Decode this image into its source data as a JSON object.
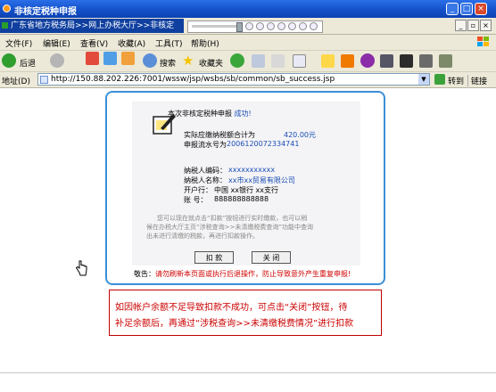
{
  "window": {
    "title": "非核定税种申报",
    "buttons": [
      "_",
      "□",
      "×"
    ]
  },
  "tab": {
    "title": "广东省地方税务局>>网上办税大厅>>非核定"
  },
  "menu": {
    "items": [
      "文件(F)",
      "编辑(E)",
      "查看(V)",
      "收藏(A)",
      "工具(T)",
      "帮助(H)"
    ]
  },
  "toolbar": {
    "back_label": "后退",
    "search_label": "搜索",
    "favorites_label": "收藏夹"
  },
  "address": {
    "label": "地址(D)",
    "url": "http://150.88.202.226:7001/wssw/jsp/wsbs/sb/common/sb_success.jsp",
    "go_label": "转到",
    "links_label": "链接"
  },
  "result": {
    "heading_prefix": "本次非核定税种申报",
    "heading_status": "成功!",
    "total_label": "实际应缴纳税额合计为",
    "total_value": "420.00元",
    "serial_label": "申报流水号为",
    "serial_value": "2006120072334741",
    "taxpayer_code_label": "纳税人编码：",
    "taxpayer_code_value": "xxxxxxxxxxx",
    "taxpayer_name_label": "纳税人名称：",
    "taxpayer_name_value": "xx市xx贸易有限公司",
    "bank_label": "开户行：",
    "bank_value": "中国 xx银行 xx支行",
    "account_label": "账    号：",
    "account_value": "888888888888",
    "info_lines": [
      "您可以现在就点击“扣款”按钮进行实时缴款，也可以稍",
      "候在办税大厅主页“涉税查询>>未清缴税费查询”功能中查询",
      "出未进行清缴的税款，再进行扣款操作。"
    ],
    "deduct_button": "扣 款",
    "close_button": "关 闭",
    "warning_prefix": "敬告：",
    "warning_text": "请勿刷新本页面或执行后退操作，防止导致意外产生重复申报!"
  },
  "note": {
    "line1": "如因帐户余额不足导致扣款不成功，可点击“关闭”按钮，待",
    "line2": "补足余额后，再通过“涉税查询>>未清缴税费情况”进行扣款"
  },
  "colors": {
    "titlebar": "#1451c9",
    "panel_border": "#3b8fd6",
    "link_blue": "#1a4db5",
    "warning_red": "#d00000",
    "note_red": "#cc0000"
  }
}
